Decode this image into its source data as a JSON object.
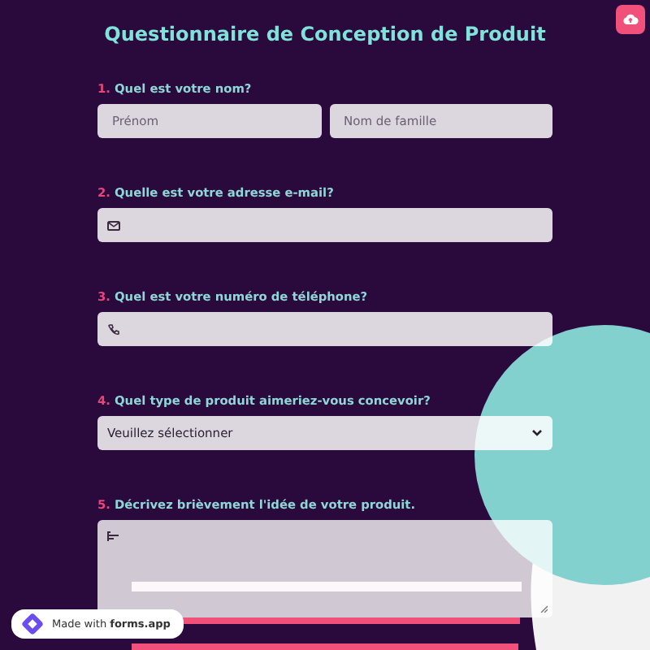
{
  "header": {
    "title": "Questionnaire de Conception de Produit"
  },
  "questions": [
    {
      "number": "1.",
      "label": "Quel est votre nom?",
      "kind": "name",
      "fields": [
        {
          "placeholder": "Prénom"
        },
        {
          "placeholder": "Nom de famille"
        }
      ]
    },
    {
      "number": "2.",
      "label": "Quelle est votre adresse e-mail?",
      "kind": "email"
    },
    {
      "number": "3.",
      "label": "Quel est votre numéro de téléphone?",
      "kind": "phone"
    },
    {
      "number": "4.",
      "label": "Quel type de produit aimeriez-vous concevoir?",
      "kind": "select",
      "value": "Veuillez sélectionner"
    },
    {
      "number": "5.",
      "label": "Décrivez brièvement l'idée de votre produit.",
      "kind": "textarea"
    }
  ],
  "badge": {
    "text": "Made with **forms.app**"
  }
}
